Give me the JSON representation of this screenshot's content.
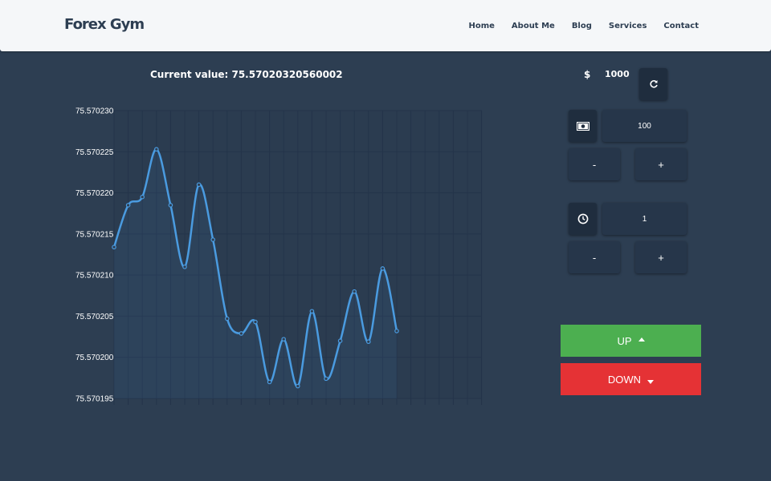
{
  "nav": {
    "brand": "Forex Gym",
    "links": [
      "Home",
      "About Me",
      "Blog",
      "Services",
      "Contact"
    ]
  },
  "trade": {
    "current_value_label": "Current value: 75.57020320560002",
    "currency_symbol": "$",
    "balance": "1000",
    "amount": "100",
    "time": "1",
    "minus_label": "-",
    "plus_label": "+",
    "up_label": "UP",
    "down_label": "DOWN"
  },
  "icons": {
    "refresh": "refresh-icon",
    "money": "money-icon",
    "clock": "clock-icon"
  },
  "colors": {
    "background": "#2d3e52",
    "navbar": "#f5f7f9",
    "line": "#4a9be0",
    "up": "#4caf50",
    "down": "#e53235"
  },
  "chart_data": {
    "type": "area",
    "y_tick_labels": [
      "75.570230",
      "75.570225",
      "75.570220",
      "75.570215",
      "75.570210",
      "75.570205",
      "75.570200",
      "75.570195"
    ],
    "ylim": [
      75.570195,
      75.57023
    ],
    "x": [
      1,
      2,
      3,
      4,
      5,
      6,
      7,
      8,
      9,
      10,
      11,
      12,
      13,
      14,
      15,
      16,
      17,
      18,
      19,
      20,
      21
    ],
    "values": [
      75.5702134,
      75.5702185,
      75.5702195,
      75.5702253,
      75.5702185,
      75.570211,
      75.570221,
      75.5702143,
      75.5702047,
      75.5702029,
      75.5702043,
      75.570197,
      75.5702022,
      75.5701965,
      75.5702056,
      75.5701974,
      75.570202,
      75.570208,
      75.5702019,
      75.5702108,
      75.5702032
    ],
    "grid": true
  }
}
